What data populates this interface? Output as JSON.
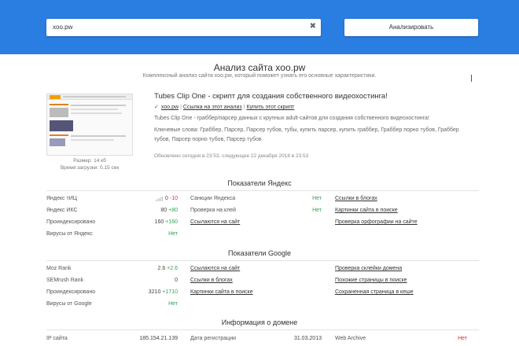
{
  "search": {
    "value": "xoo.pw",
    "clear_symbol": "✖",
    "button_label": "Анализировать"
  },
  "header": {
    "title": "Анализ сайта xoo.pw",
    "subtitle": "Комплексный анализ сайта xoo.pw, который поможет узнать его основные характеристики."
  },
  "site": {
    "thumb_size": "Размер: 14 кб",
    "thumb_load": "Время загрузки: 0.15 сек",
    "title": "Tubes Clip One - скрипт для создания собственного видеохостинга!",
    "link_domain": "xoo.pw",
    "link_analysis": "Ссылка на этот анализ",
    "link_script": "Купить этот скрипт",
    "description": "Tubes Clip One - граббер/парсер данных с крупных adult-сайтов для создания собственного видеохостинга!",
    "keywords": "Ключевые слова: Граббер, Парсер, Парсер тубов, тубы, купить парсер, купить граббер, Граббер порно тубов, Граббер тубов, Парсер порно тубов, Парсер тубов",
    "updated": "Обновлено сегодня в 23:53, следующее 22 декабря 2018 в 23:53"
  },
  "yandex": {
    "title": "Показатели Яндекс",
    "col1": [
      {
        "label": "Яндекс тИЦ",
        "value": "0",
        "delta": "-10",
        "delta_color": "red",
        "bars": true
      },
      {
        "label": "Яндекс ИКС",
        "value": "80",
        "delta": "+80",
        "delta_color": "green"
      },
      {
        "label": "Проиндексировано",
        "value": "160",
        "delta": "+160",
        "delta_color": "green"
      },
      {
        "label": "Вирусы от Яндекс",
        "value": "Нет",
        "value_color": "green"
      }
    ],
    "col2": [
      {
        "label": "Санкции Яндекса",
        "value": "Нет",
        "value_color": "green"
      },
      {
        "label": "Проверка на клей",
        "value": "Нет",
        "value_color": "green"
      },
      {
        "label": "Ссылаются на сайт",
        "link": true
      }
    ],
    "col3": [
      "Ссылки в блогах",
      "Картинки сайта в поиске",
      "Проверка орфографии на сайте"
    ]
  },
  "google": {
    "title": "Показатели Google",
    "col1": [
      {
        "label": "Moz Rank",
        "value": "2.6",
        "delta": "+2.6",
        "delta_color": "green"
      },
      {
        "label": "SEMrush Rank",
        "value": "0"
      },
      {
        "label": "Проиндексировано",
        "value": "3210",
        "delta": "+1710",
        "delta_color": "green"
      },
      {
        "label": "Вирусы от Google",
        "value": "Нет",
        "value_color": "green"
      }
    ],
    "col2": [
      "Ссылаются на сайт",
      "Ссылки в блогах",
      "Картинки сайта в поиске"
    ],
    "col3": [
      "Проверка склейки домена",
      "Похожие страницы в поиске",
      "Сохраненная страница в кеше"
    ]
  },
  "domain": {
    "title": "Информация о домене",
    "ip_label": "IP сайта",
    "ip_value": "185.154.21.139",
    "reg_label": "Дата регистрации",
    "reg_value": "31.03.2013",
    "archive_label": "Web Archive",
    "archive_value": "Нет"
  },
  "colors": {
    "topbar": "#2a7de1",
    "green": "#2ea44f",
    "red": "#d9302c"
  }
}
